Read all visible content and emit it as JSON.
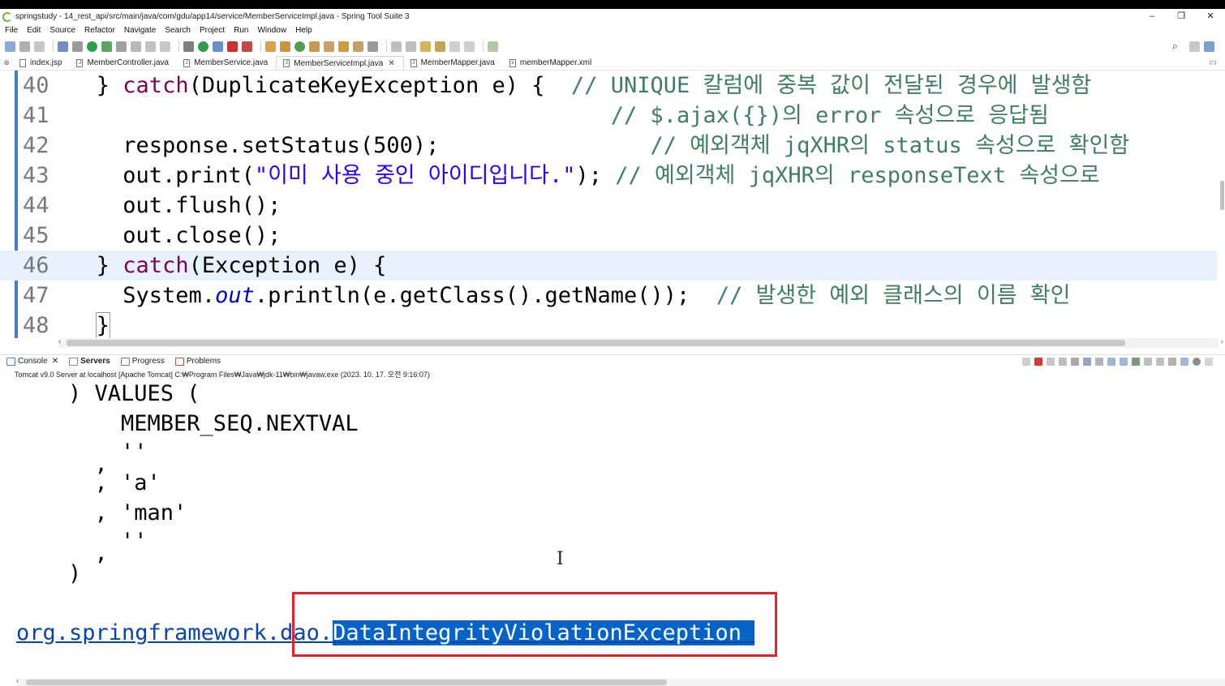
{
  "window": {
    "title": "springstudy - 14_rest_api/src/main/java/com/gdu/app14/service/MemberServiceImpl.java - Spring Tool Suite 3",
    "controls": [
      "–",
      "❐",
      "✕"
    ]
  },
  "menu": [
    "File",
    "Edit",
    "Source",
    "Refactor",
    "Navigate",
    "Search",
    "Project",
    "Run",
    "Window",
    "Help"
  ],
  "editor_tabs": [
    {
      "label": "index.jsp",
      "icon": "jsp-file-icon",
      "active": false
    },
    {
      "label": "MemberController.java",
      "icon": "java-file-icon",
      "active": false
    },
    {
      "label": "MemberService.java",
      "icon": "java-file-icon",
      "active": false
    },
    {
      "label": "MemberServiceImpl.java",
      "icon": "java-file-icon",
      "active": true
    },
    {
      "label": "MemberMapper.java",
      "icon": "java-file-icon",
      "active": false
    },
    {
      "label": "memberMapper.xml",
      "icon": "xml-file-icon",
      "active": false
    }
  ],
  "code": {
    "highlighted_line": "46",
    "lines": [
      {
        "num": "40",
        "indent": "   ",
        "brace_open": "} ",
        "kw": "catch",
        "rest": "(DuplicateKeyException e) {  ",
        "comment": "// UNIQUE 칼럼에 중복 값이 전달된 경우에 발생함"
      },
      {
        "num": "41",
        "indent": "                                          ",
        "comment": "// $.ajax({})의 error 속성으로 응답됨"
      },
      {
        "num": "42",
        "indent": "     ",
        "text": "response.setStatus(500);                ",
        "comment": "// 예외객체 jqXHR의 status 속성으로 확인함"
      },
      {
        "num": "43",
        "indent": "     ",
        "pre": "out.print(",
        "string": "\"이미 사용 중인 아이디입니다.\"",
        "post": "); ",
        "comment": "// 예외객체 jqXHR의 responseText 속성으로"
      },
      {
        "num": "44",
        "indent": "     ",
        "text": "out.flush();"
      },
      {
        "num": "45",
        "indent": "     ",
        "text": "out.close();"
      },
      {
        "num": "46",
        "indent": "   ",
        "brace_open": "} ",
        "kw": "catch",
        "rest": "(Exception e) {"
      },
      {
        "num": "47",
        "indent": "     ",
        "pre": "System.",
        "field": "out",
        "post": ".println(e.getClass().getName());  ",
        "comment": "// 발생한 예외 클래스의 이름 확인"
      },
      {
        "num": "48",
        "indent": "   ",
        "text": "}"
      }
    ]
  },
  "console_tabs": [
    {
      "label": "Console",
      "closable": true,
      "bold": false
    },
    {
      "label": "Servers",
      "closable": false,
      "bold": true
    },
    {
      "label": "Progress",
      "closable": false,
      "bold": false
    },
    {
      "label": "Problems",
      "closable": false,
      "bold": false
    }
  ],
  "console_header": "Tomcat v9.0 Server at localhost [Apache Tomcat] C:₩Program Files₩Java₩jdk-11₩bin₩javaw.exe  (2023. 10. 17. 오전 9:16:07)",
  "console_lines": [
    ") VALUES (",
    "    MEMBER_SEQ.NEXTVAL",
    "    ''",
    "  ,",
    "  , 'a'",
    "  , 'man'",
    "    ''",
    "  ,",
    ")"
  ],
  "exception": {
    "package": "org.springframework.dao.",
    "class_name": "DataIntegrityViolationException "
  },
  "colors": {
    "keyword": "#7f0055",
    "string": "#2a00ff",
    "comment": "#3f7f5f",
    "selection": "#0563c8",
    "annotation_box": "#e8222a"
  }
}
